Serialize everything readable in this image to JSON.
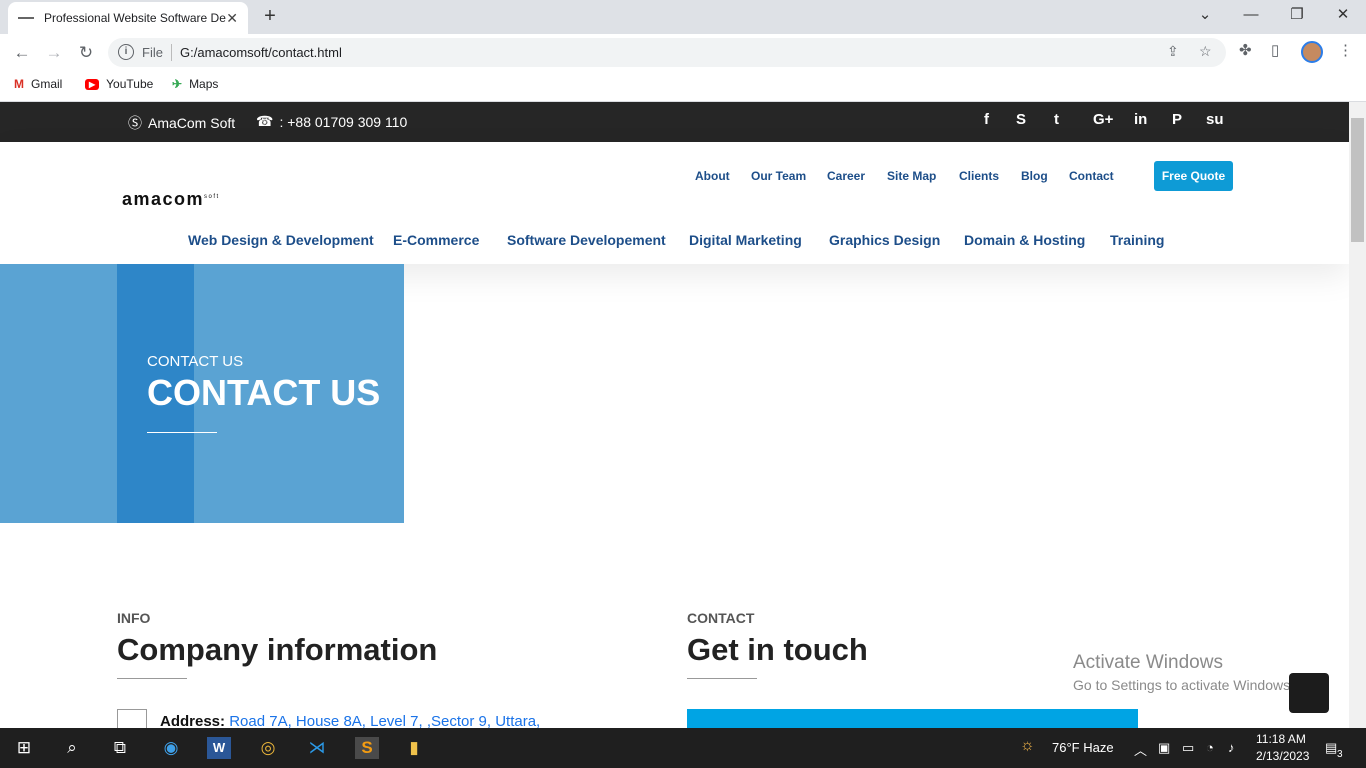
{
  "browser": {
    "tab_title": "Professional Website Software De",
    "scheme": "File",
    "url": "G:/amacomsoft/contact.html",
    "bookmarks": [
      "Gmail",
      "YouTube",
      "Maps"
    ]
  },
  "topbar": {
    "skype": "AmaCom Soft",
    "phone": ": +88 01709 309 110",
    "social": [
      "f",
      "S",
      "t",
      "G+",
      "in",
      "P",
      "su"
    ]
  },
  "header": {
    "logo": "amacom",
    "logo_sup": "soft",
    "top_nav": [
      "About",
      "Our Team",
      "Career",
      "Site Map",
      "Clients",
      "Blog",
      "Contact"
    ],
    "quote_button": "Free Quote",
    "main_nav": [
      "Web Design & Development",
      "E-Commerce",
      "Software Developement",
      "Digital Marketing",
      "Graphics Design",
      "Domain & Hosting",
      "Training"
    ]
  },
  "hero": {
    "small": "CONTACT US",
    "big": "CONTACT US"
  },
  "info": {
    "label": "INFO",
    "title": "Company information",
    "address_label": "Address:",
    "address_value": "Road 7A, House 8A, Level 7, ,Sector 9, Uttara,"
  },
  "contact": {
    "label": "CONTACT",
    "title": "Get in touch"
  },
  "watermark": {
    "line1": "Activate Windows",
    "line2": "Go to Settings to activate Windows."
  },
  "taskbar": {
    "weather": "76°F  Haze",
    "time": "11:18 AM",
    "date": "2/13/2023",
    "notifications": "3"
  }
}
